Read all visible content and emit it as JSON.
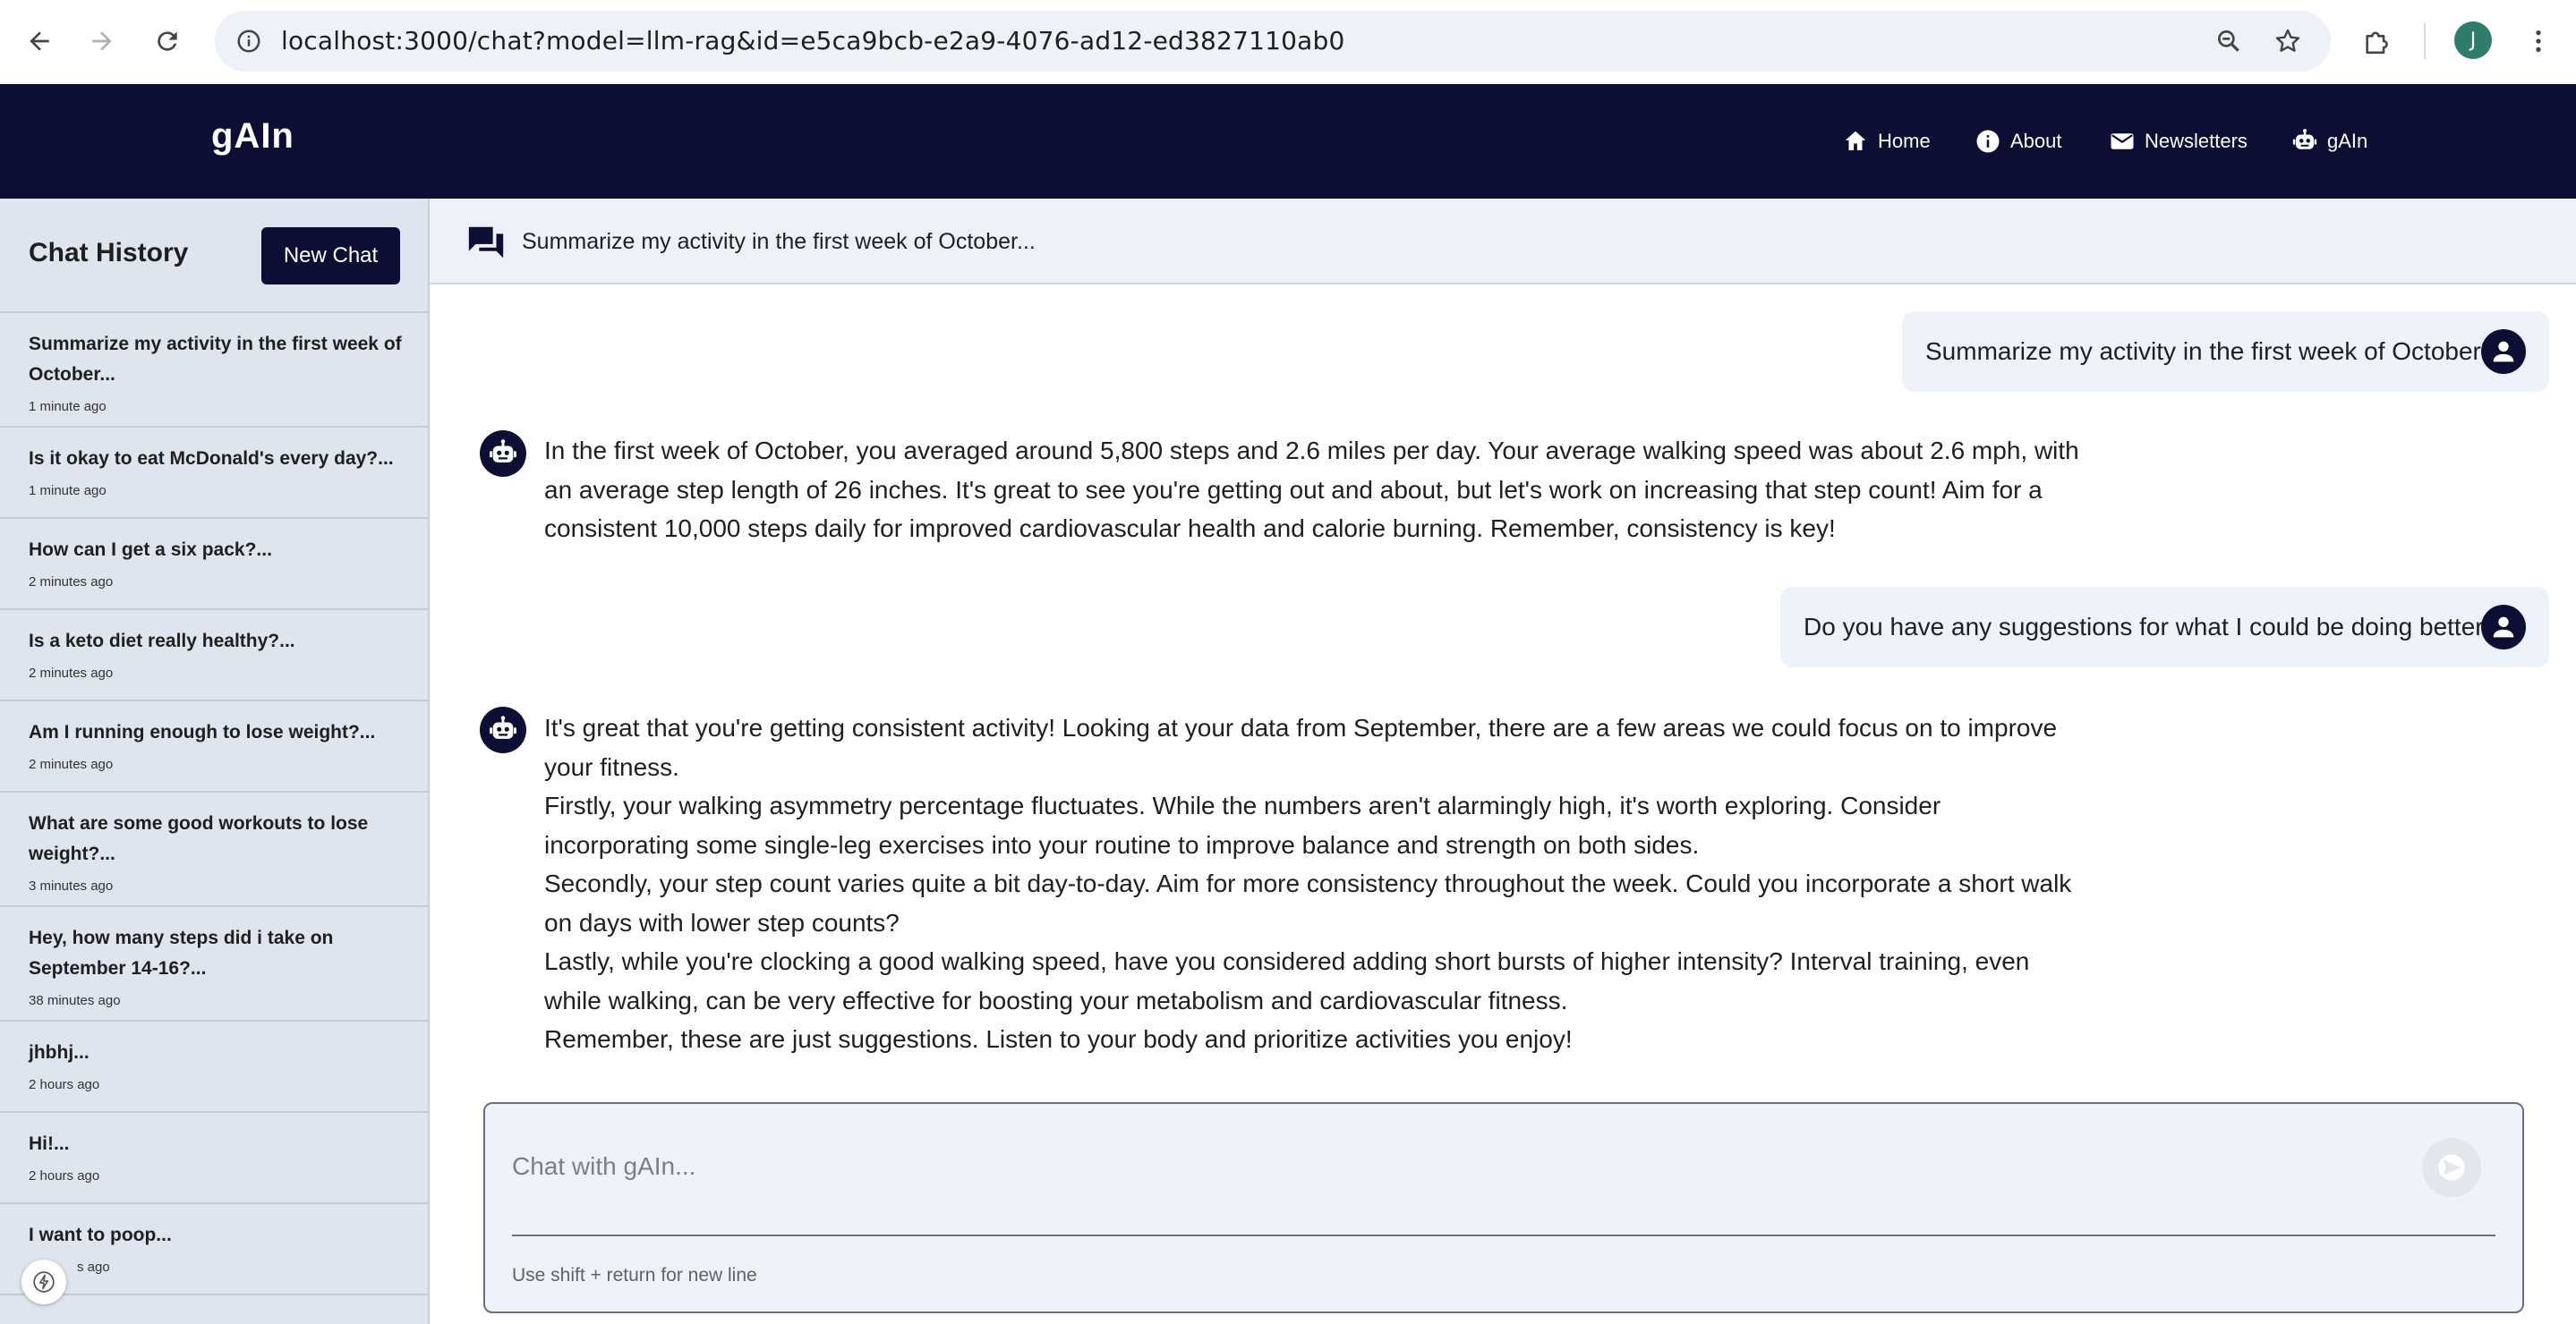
{
  "browser": {
    "url": "localhost:3000/chat?model=llm-rag&id=e5ca9bcb-e2a9-4076-ad12-ed3827110ab0",
    "profile_initial": "J",
    "icons": {
      "back": "arrow-left-icon",
      "forward": "arrow-right-icon",
      "reload": "reload-icon",
      "site_info": "info-circle-icon",
      "zoom": "magnifier-icon",
      "bookmark": "star-icon",
      "extensions": "puzzle-icon",
      "menu": "kebab-menu-icon"
    }
  },
  "header": {
    "brand": "gAIn",
    "background": "#0c0e33",
    "nav": [
      {
        "label": "Home",
        "icon": "home-icon"
      },
      {
        "label": "About",
        "icon": "info-icon"
      },
      {
        "label": "Newsletters",
        "icon": "mail-icon"
      },
      {
        "label": "gAIn",
        "icon": "robot-icon"
      }
    ]
  },
  "sidebar": {
    "title": "Chat History",
    "new_chat_label": "New Chat",
    "items": [
      {
        "title": "Summarize my activity in the first week of October...",
        "time": "1 minute ago"
      },
      {
        "title": "Is it okay to eat McDonald's every day?...",
        "time": "1 minute ago"
      },
      {
        "title": "How can I get a six pack?...",
        "time": "2 minutes ago"
      },
      {
        "title": "Is a keto diet really healthy?...",
        "time": "2 minutes ago"
      },
      {
        "title": "Am I running enough to lose weight?...",
        "time": "2 minutes ago"
      },
      {
        "title": "What are some good workouts to lose weight?...",
        "time": "3 minutes ago"
      },
      {
        "title": "Hey, how many steps did i take on September 14-16?...",
        "time": "38 minutes ago"
      },
      {
        "title": "jhbhj...",
        "time": "2 hours ago"
      },
      {
        "title": "Hi!...",
        "time": "2 hours ago"
      },
      {
        "title": "I want to poop...",
        "time": "s ago"
      }
    ]
  },
  "chat": {
    "title": "Summarize my activity in the first week of October...",
    "messages": [
      {
        "role": "user",
        "text": "Summarize my activity in the first week of October"
      },
      {
        "role": "assistant",
        "paragraphs": [
          "In the first week of October, you averaged around 5,800 steps and 2.6 miles per day. Your average walking speed was about 2.6 mph, with an average step length of 26 inches. It's great to see you're getting out and about, but let's work on increasing that step count! Aim for a consistent 10,000 steps daily for improved cardiovascular health and calorie burning. Remember, consistency is key!"
        ]
      },
      {
        "role": "user",
        "text": "Do you have any suggestions for what I could be doing better?"
      },
      {
        "role": "assistant",
        "paragraphs": [
          "It's great that you're getting consistent activity! Looking at your data from September, there are a few areas we could focus on to improve your fitness.",
          "Firstly, your walking asymmetry percentage fluctuates. While the numbers aren't alarmingly high, it's worth exploring. Consider incorporating some single-leg exercises into your routine to improve balance and strength on both sides.",
          "Secondly, your step count varies quite a bit day-to-day. Aim for more consistency throughout the week. Could you incorporate a short walk on days with lower step counts?",
          "Lastly, while you're clocking a good walking speed, have you considered adding short bursts of higher intensity? Interval training, even while walking, can be very effective for boosting your metabolism and cardiovascular fitness.",
          "Remember, these are just suggestions. Listen to your body and prioritize activities you enjoy!"
        ]
      }
    ]
  },
  "composer": {
    "placeholder": "Chat with gAIn...",
    "value": "",
    "hint": "Use shift + return for new line"
  }
}
